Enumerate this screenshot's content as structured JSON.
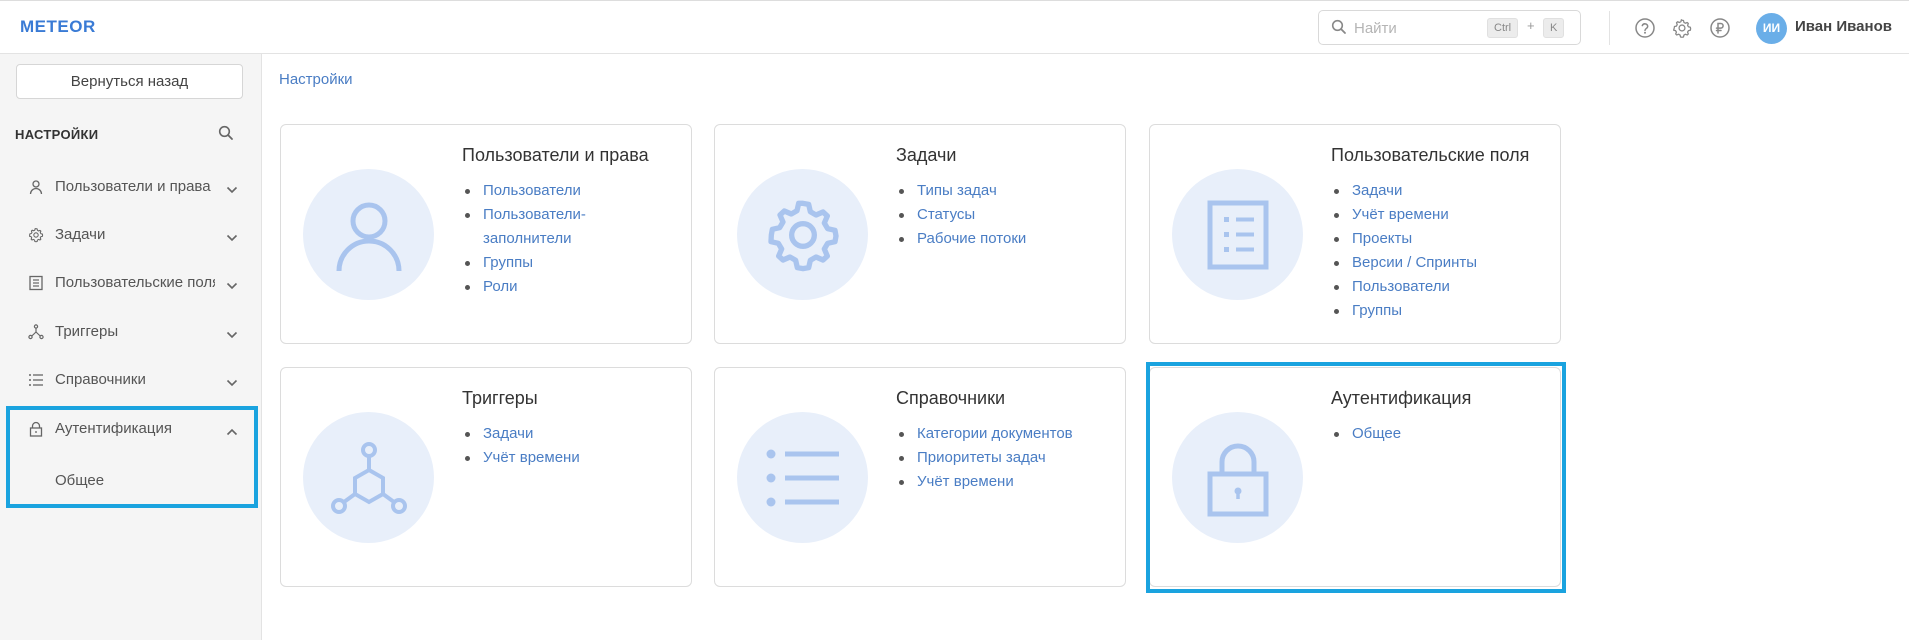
{
  "header": {
    "logo": "METEOR",
    "search_placeholder": "Найти",
    "shortcut_ctrl": "Ctrl",
    "shortcut_plus": "+",
    "shortcut_key": "K",
    "user_initials": "ИИ",
    "user_name": "Иван Иванов",
    "icons": [
      "help-icon",
      "gear-icon",
      "ruble-icon"
    ]
  },
  "sidebar": {
    "back_label": "Вернуться назад",
    "title": "НАСТРОЙКИ",
    "items": [
      {
        "label": "Пользователи и права",
        "icon": "user-icon"
      },
      {
        "label": "Задачи",
        "icon": "gear-icon"
      },
      {
        "label": "Пользовательские поля",
        "icon": "form-icon"
      },
      {
        "label": "Триггеры",
        "icon": "trigger-icon"
      },
      {
        "label": "Справочники",
        "icon": "list-icon"
      },
      {
        "label": "Аутентификация",
        "icon": "lock-icon"
      }
    ],
    "sub_item": "Общее"
  },
  "breadcrumb": "Настройки",
  "cards": [
    {
      "title": "Пользователи и права",
      "icon": "user-icon",
      "links": [
        "Пользователи",
        "Пользователи-",
        "заполнители",
        "Группы",
        "Роли"
      ]
    },
    {
      "title": "Задачи",
      "icon": "gear-icon",
      "links": [
        "Типы задач",
        "Статусы",
        "Рабочие потоки"
      ]
    },
    {
      "title": "Пользовательские поля",
      "icon": "form-icon",
      "links": [
        "Задачи",
        "Учёт времени",
        "Проекты",
        "Версии / Спринты",
        "Пользователи",
        "Группы"
      ]
    },
    {
      "title": "Триггеры",
      "icon": "trigger-icon",
      "links": [
        "Задачи",
        "Учёт времени"
      ]
    },
    {
      "title": "Справочники",
      "icon": "list-icon",
      "links": [
        "Категории документов",
        "Приоритеты задач",
        "Учёт времени"
      ]
    },
    {
      "title": "Аутентификация",
      "icon": "lock-icon",
      "links": [
        "Общее"
      ]
    }
  ],
  "colors": {
    "accent": "#4a7dc4",
    "highlight": "#1aa3df",
    "icon_fill": "#a9c4ee",
    "circle": "#e8effa"
  }
}
